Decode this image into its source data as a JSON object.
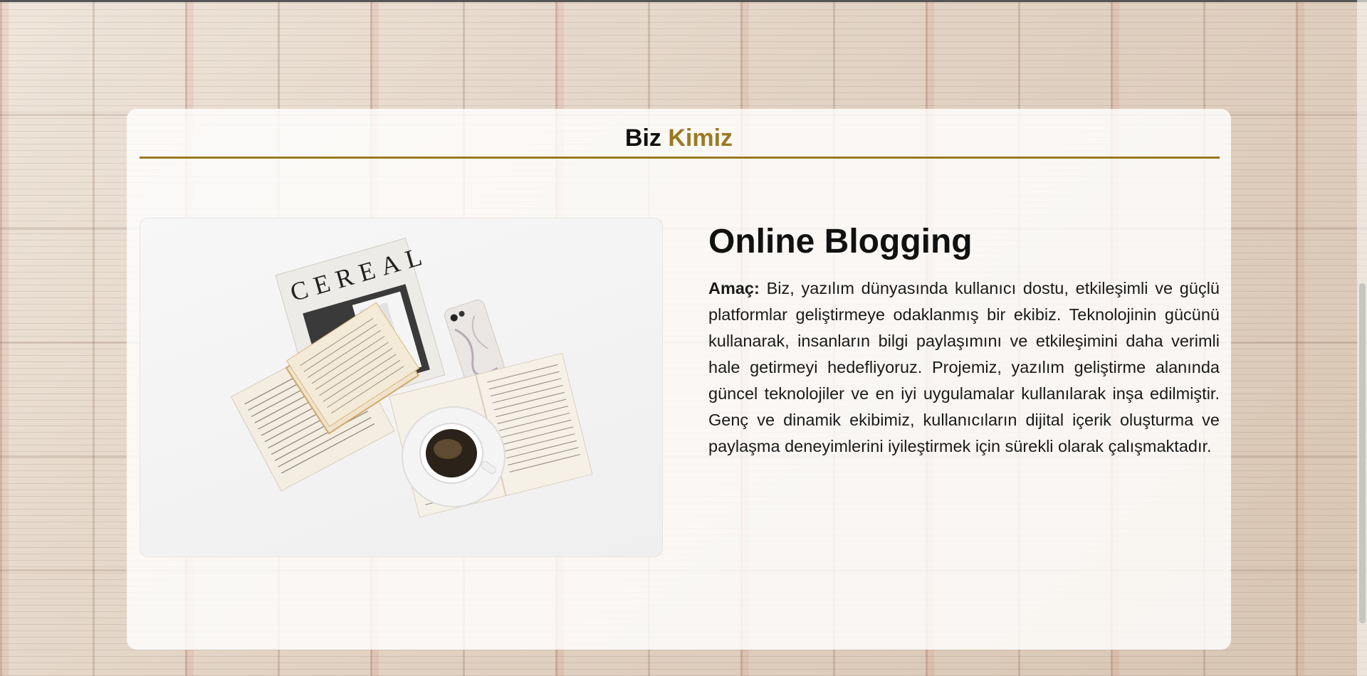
{
  "section": {
    "title_part1": "Biz",
    "title_part2": "Kimiz",
    "accent_color": "#9a7a22"
  },
  "about": {
    "heading": "Online Blogging",
    "label": "Amaç:",
    "body": "Biz, yazılım dünyasında kullanıcı dostu, etkileşimli ve güçlü platformlar geliştirmeye odaklanmış bir ekibiz. Teknolojinin gücünü kullanarak, insanların bilgi paylaşımını ve etkileşimini daha verimli hale getirmeyi hedefliyoruz. Projemiz, yazılım geliştirme alanında güncel teknolojiler ve en iyi uygulamalar kullanılarak inşa edilmiştir. Genç ve dinamik ekibimiz, kullanıcıların dijital içerik oluşturma ve paylaşma deneyimlerini iyileştirmek için sürekli olarak çalışmaktadır."
  },
  "image": {
    "magazine_title": "CEREAL",
    "subject": "magazine-books-coffee-phone"
  }
}
